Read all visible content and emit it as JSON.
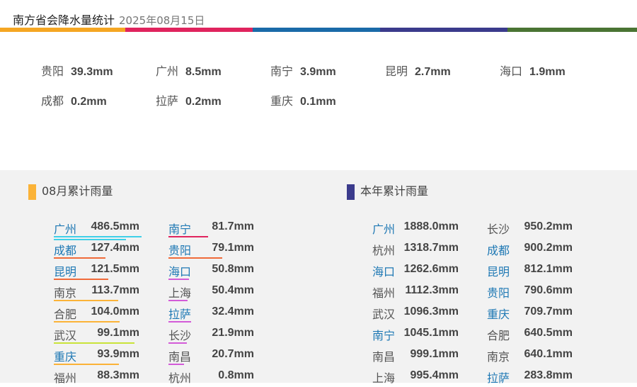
{
  "header": {
    "title": "南方省会降水量统计",
    "date": "2025年08月15日",
    "colors": [
      "#f5a623",
      "#e0245e",
      "#1a6aa8",
      "#3b3b8c",
      "#4a7433"
    ]
  },
  "daily": [
    {
      "city": "贵阳",
      "value": "39.3mm"
    },
    {
      "city": "广州",
      "value": "8.5mm"
    },
    {
      "city": "南宁",
      "value": "3.9mm"
    },
    {
      "city": "昆明",
      "value": "2.7mm"
    },
    {
      "city": "海口",
      "value": "1.9mm"
    },
    {
      "city": "成都",
      "value": "0.2mm"
    },
    {
      "city": "拉萨",
      "value": "0.2mm"
    },
    {
      "city": "重庆",
      "value": "0.1mm"
    }
  ],
  "monthly": {
    "title": "08月累计雨量",
    "accent": "#fbb338",
    "items": [
      {
        "city": "广州",
        "value": "486.5mm",
        "highlight": true,
        "line_color": "#3fd0e8",
        "line_fraction": 1.0
      },
      {
        "city": "成都",
        "value": "127.4mm",
        "highlight": true,
        "line_color": "#f06a3a",
        "line_fraction": 0.59
      },
      {
        "city": "昆明",
        "value": "121.5mm",
        "highlight": true,
        "line_color": "#f06a3a",
        "line_fraction": 0.62
      },
      {
        "city": "南京",
        "value": "113.7mm",
        "highlight": false,
        "line_color": "#fbb338",
        "line_fraction": 0.73
      },
      {
        "city": "合肥",
        "value": "104.0mm",
        "highlight": false,
        "line_color": "#fbb338",
        "line_fraction": 0.75
      },
      {
        "city": "武汉",
        "value": "99.1mm",
        "highlight": false,
        "line_color": "#c9e33a",
        "line_fraction": 0.92
      },
      {
        "city": "重庆",
        "value": "93.9mm",
        "highlight": true,
        "line_color": "#fbb338",
        "line_fraction": 0.74
      },
      {
        "city": "福州",
        "value": "88.3mm",
        "highlight": false,
        "line_color": "#fbb338",
        "line_fraction": 0.0
      },
      {
        "city": "南宁",
        "value": "81.7mm",
        "highlight": true,
        "line_color": "#e0245e",
        "line_fraction": 0.45
      },
      {
        "city": "贵阳",
        "value": "79.1mm",
        "highlight": true,
        "line_color": "#f06a3a",
        "line_fraction": 0.61
      },
      {
        "city": "海口",
        "value": "50.8mm",
        "highlight": true,
        "line_color": "#d35bd8",
        "line_fraction": 0.23
      },
      {
        "city": "上海",
        "value": "50.4mm",
        "highlight": false,
        "line_color": "#d35bd8",
        "line_fraction": 0.22
      },
      {
        "city": "拉萨",
        "value": "32.4mm",
        "highlight": true,
        "line_color": "#d35bd8",
        "line_fraction": 0.26
      },
      {
        "city": "长沙",
        "value": "21.9mm",
        "highlight": false,
        "line_color": "#d35bd8",
        "line_fraction": 0.21
      },
      {
        "city": "南昌",
        "value": "20.7mm",
        "highlight": false,
        "line_color": "#d35bd8",
        "line_fraction": 0.18
      },
      {
        "city": "杭州",
        "value": "0.8mm",
        "highlight": false,
        "line_color": "#d35bd8",
        "line_fraction": 0.0
      }
    ]
  },
  "yearly": {
    "title": "本年累计雨量",
    "accent": "#3b3b8c",
    "items": [
      {
        "city": "广州",
        "value": "1888.0mm",
        "highlight": true
      },
      {
        "city": "杭州",
        "value": "1318.7mm",
        "highlight": false
      },
      {
        "city": "海口",
        "value": "1262.6mm",
        "highlight": true
      },
      {
        "city": "福州",
        "value": "1112.3mm",
        "highlight": false
      },
      {
        "city": "武汉",
        "value": "1096.3mm",
        "highlight": false
      },
      {
        "city": "南宁",
        "value": "1045.1mm",
        "highlight": true
      },
      {
        "city": "南昌",
        "value": "999.1mm",
        "highlight": false
      },
      {
        "city": "上海",
        "value": "995.4mm",
        "highlight": false
      },
      {
        "city": "长沙",
        "value": "950.2mm",
        "highlight": false
      },
      {
        "city": "成都",
        "value": "900.2mm",
        "highlight": true
      },
      {
        "city": "昆明",
        "value": "812.1mm",
        "highlight": true
      },
      {
        "city": "贵阳",
        "value": "790.6mm",
        "highlight": true
      },
      {
        "city": "重庆",
        "value": "709.7mm",
        "highlight": true
      },
      {
        "city": "合肥",
        "value": "640.5mm",
        "highlight": false
      },
      {
        "city": "南京",
        "value": "640.1mm",
        "highlight": false
      },
      {
        "city": "拉萨",
        "value": "283.8mm",
        "highlight": true
      }
    ]
  }
}
